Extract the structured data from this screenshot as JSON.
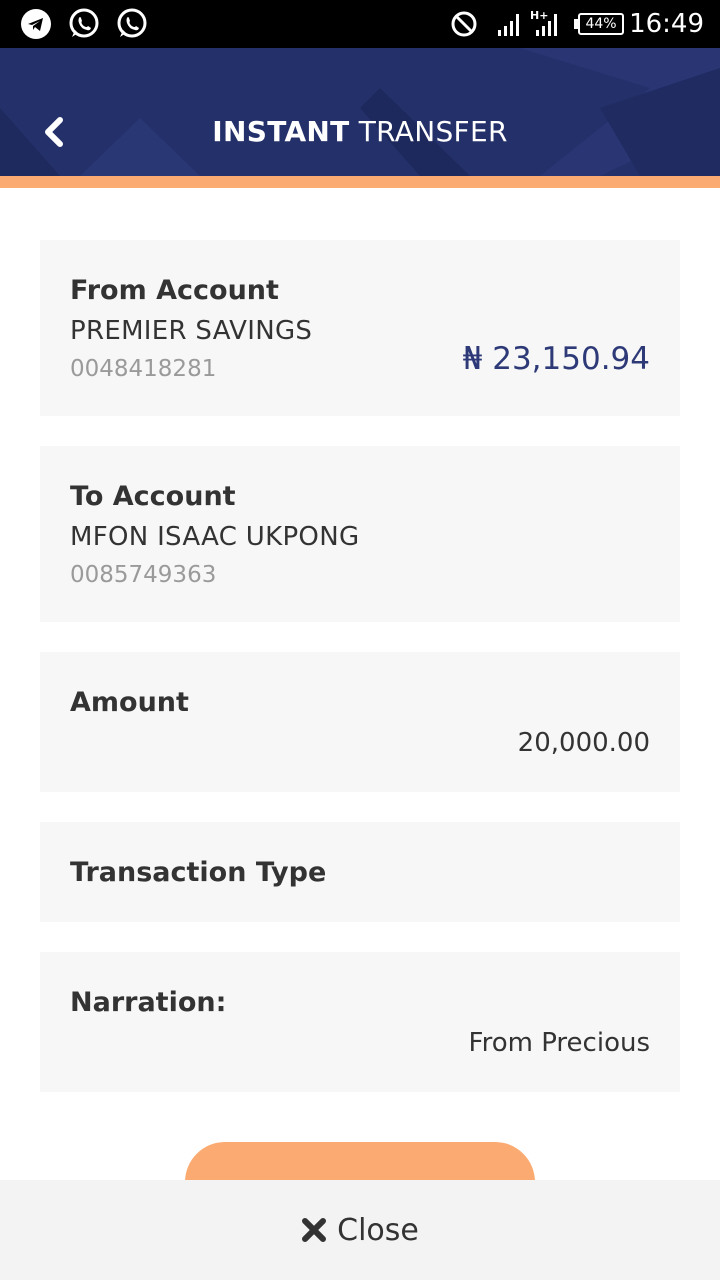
{
  "status_bar": {
    "time": "16:49",
    "battery": "44%",
    "icons": [
      "telegram-icon",
      "whatsapp-icon",
      "whatsapp-icon",
      "do-not-disturb-icon",
      "signal-icon",
      "hplus-signal-icon",
      "battery-icon"
    ]
  },
  "header": {
    "title_bold": "INSTANT",
    "title_rest": " TRANSFER",
    "back_icon": "chevron-left-icon",
    "color": "#23306a",
    "accent_color": "#fbab72"
  },
  "from_account": {
    "label": "From Account",
    "name": "PREMIER SAVINGS",
    "number": "0048418281",
    "balance": "₦ 23,150.94"
  },
  "to_account": {
    "label": "To Account",
    "name": "MFON ISAAC UKPONG",
    "number": "0085749363"
  },
  "amount": {
    "label": "Amount",
    "value": "20,000.00"
  },
  "transaction_type": {
    "label": "Transaction Type"
  },
  "narration": {
    "label": "Narration:",
    "value": "From Precious"
  },
  "close": {
    "icon": "close-icon",
    "label": "Close"
  }
}
